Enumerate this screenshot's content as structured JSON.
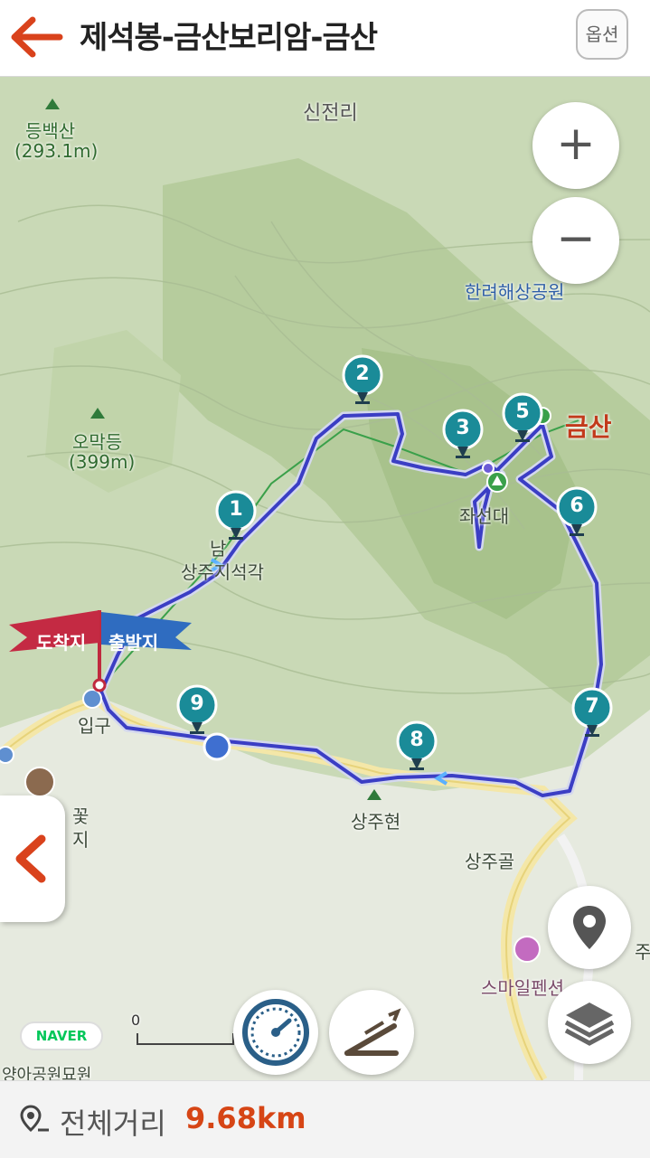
{
  "header": {
    "title": "제석봉-금산보리암-금산",
    "option_label": "옵션"
  },
  "map": {
    "labels": {
      "sinjeonri": "신전리",
      "deungbaeksan": "등백산",
      "deungbaeksan_elev": "(293.1m)",
      "omakdeung": "오막등",
      "omakdeung_elev": "(399m)",
      "hallyeo": "한려해상공원",
      "geumsan": "금산",
      "jwaseondae": "좌선대",
      "nam": "남",
      "sangju_seokgak": "상주지석각",
      "ipgu": "입구",
      "sangjuhyeon": "상주현",
      "sangjugol": "상주골",
      "smile": "스마일펜션",
      "kkot": "꽃",
      "ji": "지",
      "ju": "주",
      "yangah": "양아공원묘원"
    },
    "flags": {
      "arrival": "도착지",
      "departure": "출발지"
    },
    "waypoints": [
      "1",
      "2",
      "3",
      "5",
      "6",
      "7",
      "8",
      "9"
    ],
    "zoom_in": "+",
    "zoom_out": "−",
    "naver": "NAVER",
    "scale": "0"
  },
  "footer": {
    "distance_label": "전체거리",
    "distance_value": "9.68km"
  },
  "colors": {
    "accent": "#d64515",
    "route": "#3b3ec4",
    "marker": "#1a8b98"
  }
}
